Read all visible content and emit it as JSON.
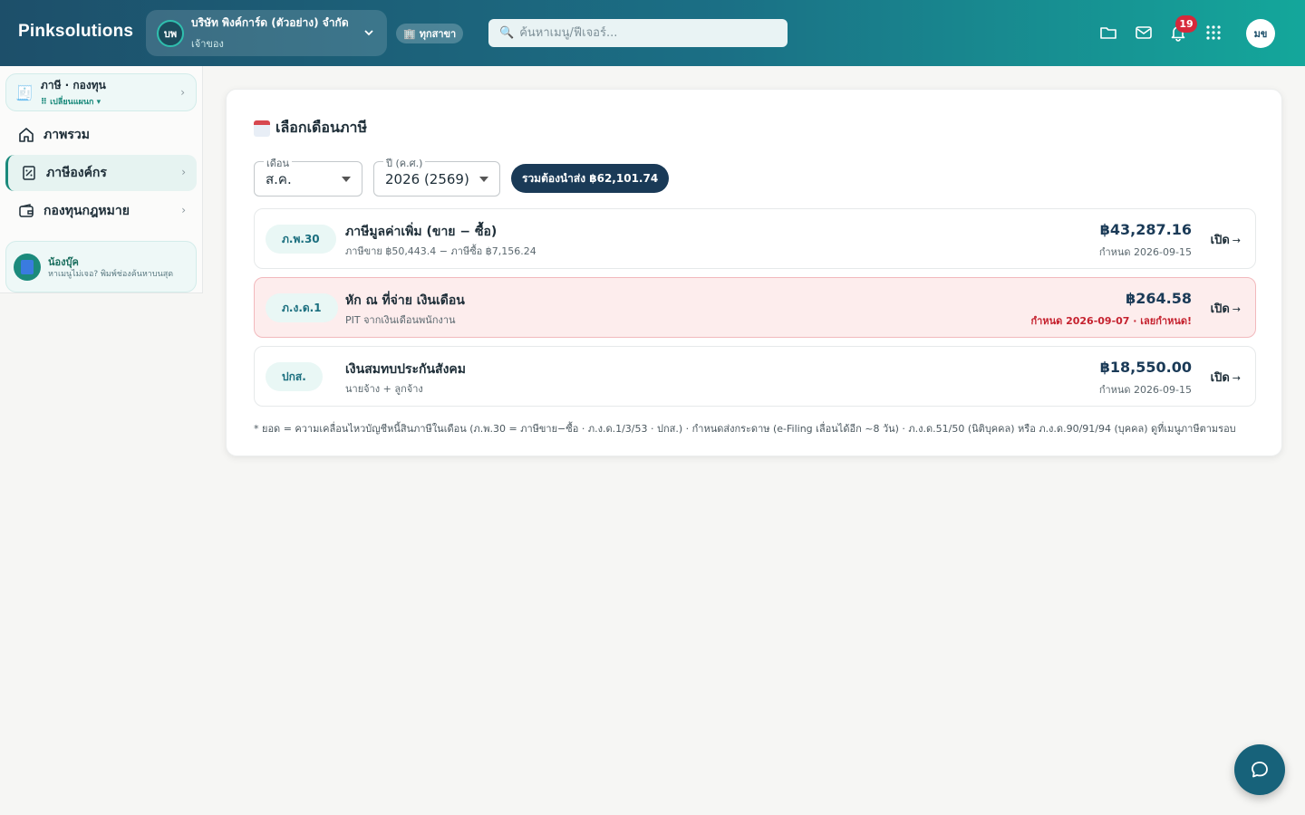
{
  "app": {
    "brand": "Pinksolutions"
  },
  "company": {
    "initials": "บพ",
    "name": "บริษัท พิงค์การ์ด (ตัวอย่าง) จำกัด",
    "role": "เจ้าของ"
  },
  "branch": {
    "icon": "🏢",
    "label": "ทุกสาขา"
  },
  "search": {
    "placeholder": "ค้นหาเมนู/ฟีเจอร์..."
  },
  "toolbar": {
    "notification_count": "19",
    "user_initials": "มข"
  },
  "sidebar": {
    "dept_title": "ภาษี · กองทุน",
    "dept_switch": "⠿ เปลี่ยนแผนก ▾",
    "items": [
      {
        "label": "ภาพรวม"
      },
      {
        "label": "ภาษีองค์กร"
      },
      {
        "label": "กองทุนกฎหมาย"
      }
    ],
    "help_title": "น้องบุ๊ค",
    "help_text": "หาเมนูไม่เจอ? พิมพ์ช่องค้นหาบนสุด"
  },
  "main": {
    "title": "เลือกเดือนภาษี",
    "month_label": "เดือน",
    "month_value": "ส.ค.",
    "year_label": "ปี (ค.ศ.)",
    "year_value": "2026 (2569)",
    "total_label": "รวมต้องนำส่ง ฿62,101.74",
    "open_label": "เปิด",
    "rows": [
      {
        "code": "ภ.พ.30",
        "title": "ภาษีมูลค่าเพิ่ม (ขาย − ซื้อ)",
        "sub": "ภาษีขาย ฿50,443.4 − ภาษีซื้อ ฿7,156.24",
        "amount": "฿43,287.16",
        "due": "กำหนด 2026-09-15",
        "status": "normal"
      },
      {
        "code": "ภ.ง.ด.1",
        "title": "หัก ณ ที่จ่าย เงินเดือน",
        "sub": "PIT จากเงินเดือนพนักงาน",
        "amount": "฿264.58",
        "due": "กำหนด 2026-09-07 · เลยกำหนด!",
        "status": "overdue"
      },
      {
        "code": "ปกส.",
        "title": "เงินสมทบประกันสังคม",
        "sub": "นายจ้าง + ลูกจ้าง",
        "amount": "฿18,550.00",
        "due": "กำหนด 2026-09-15",
        "status": "normal"
      }
    ],
    "footnote": "* ยอด = ความเคลื่อนไหวบัญชีหนี้สินภาษีในเดือน (ภ.พ.30 = ภาษีขาย−ซื้อ · ภ.ง.ด.1/3/53 · ปกส.) · กำหนดส่งกระดาษ (e-Filing เลื่อนได้อีก ~8 วัน) · ภ.ง.ด.51/50 (นิติบุคคล) หรือ ภ.ง.ด.90/91/94 (บุคคล) ดูที่เมนูภาษีตามรอบ"
  },
  "colors": {
    "accent": "#1b8a7c",
    "header_start": "#1d4f6a",
    "header_end": "#14a79b",
    "danger": "#c5222f",
    "pill": "#1a3a57"
  }
}
